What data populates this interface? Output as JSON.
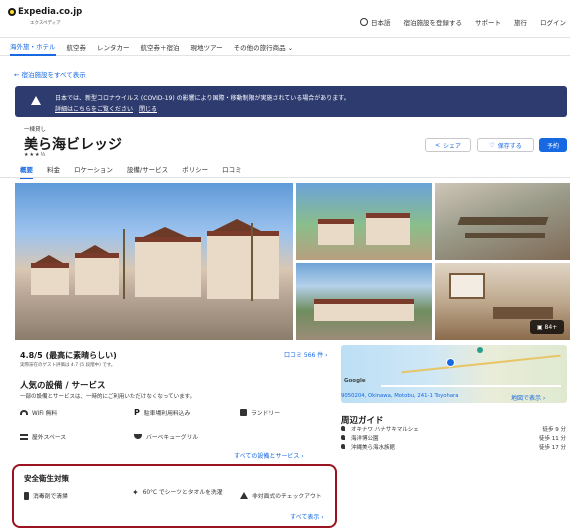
{
  "header": {
    "logo": "Expedia.co.jp",
    "logo_sub": "エクスペディア",
    "nav": [
      "日本語",
      "宿泊施設を登録する",
      "サポート",
      "旅行",
      "ログイン"
    ]
  },
  "category_nav": [
    "海外旅・ホテル",
    "航空券",
    "レンタカー",
    "航空券＋宿泊",
    "現地ツアー",
    "その他の旅行商品 ⌄"
  ],
  "back_link": "← 宿泊施設をすべて表示",
  "notice": {
    "line1": "日本では、新型コロナウイルス (COVID-19) の影響により国際・移動制限が実施されている場合があります。",
    "link": "詳細はこちらをご覧ください",
    "close": "閉じる"
  },
  "hotel": {
    "type_label": "一棟貸し",
    "name": "美ら海ビレッジ",
    "stars": "★★★½"
  },
  "actions": {
    "share": "シェア",
    "save": "保存する",
    "book": "予約"
  },
  "tabs": [
    "概要",
    "料金",
    "ロケーション",
    "設備/サービス",
    "ポリシー",
    "口コミ"
  ],
  "gallery": {
    "badge": "84+"
  },
  "rating": {
    "score": "4.8/5 (最高に素晴らしい)",
    "sub": "実際滞在のゲスト評価は 4.7 (5 段階中) です。",
    "reviews_link": "口コミ 566 件 ›"
  },
  "amenities": {
    "title": "人気の設備 / サービス",
    "subtitle": "一部の設備とサービスは、一時的にご利用いただけなくなっています。",
    "items": [
      "WiFi 無料",
      "駐車場利用料込み",
      "ランドリー",
      "屋外スペース",
      "バーベキューグリル"
    ],
    "all_link": "すべての設備とサービス ›"
  },
  "map": {
    "google": "Google",
    "address": "9050204, Okinawa, Motobu, 241-1 Toyohara",
    "map_link": "地図で表示 ›"
  },
  "guide": {
    "title": "周辺ガイド",
    "items": [
      {
        "name": "オキナワ ハナサキマルシェ",
        "dist": "徒歩 9 分"
      },
      {
        "name": "海洋博公園",
        "dist": "徒歩 11 分"
      },
      {
        "name": "沖縄美ら海水族館",
        "dist": "徒歩 17 分"
      }
    ]
  },
  "safety": {
    "title": "安全衛生対策",
    "items": [
      "消毒剤で清掃",
      "60°C でシーツとタオルを洗濯",
      "非対面式のチェックアウト"
    ],
    "all_link": "すべて表示 ›"
  }
}
